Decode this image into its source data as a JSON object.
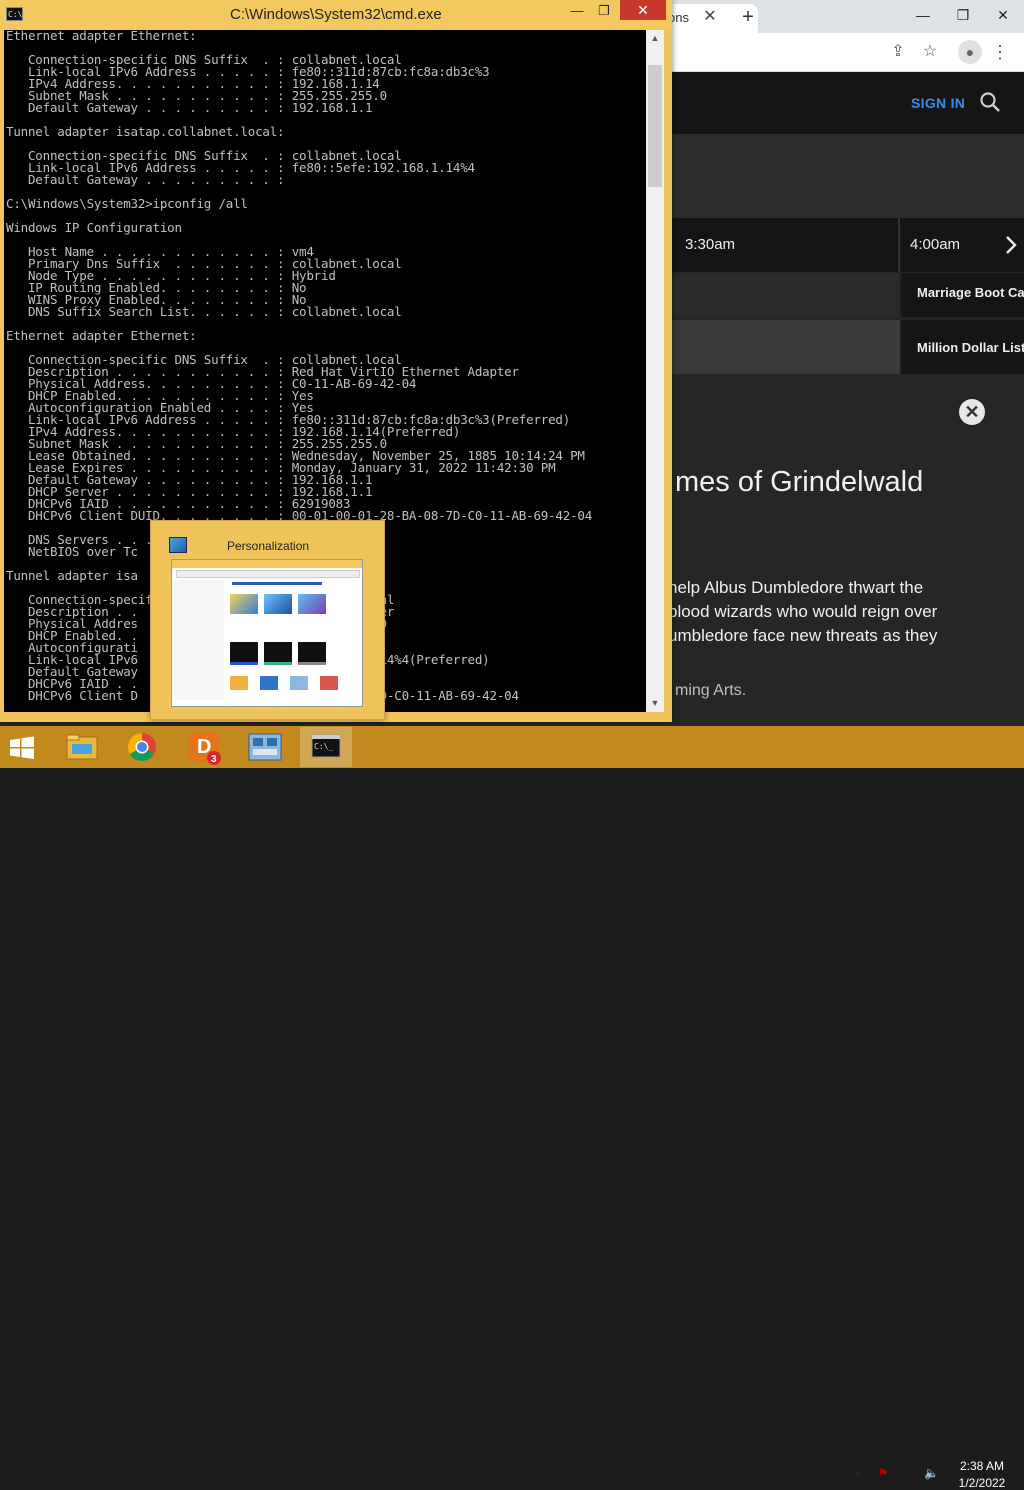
{
  "browser": {
    "tab_title": "ons",
    "tab_close": "✕",
    "new_tab": "+",
    "window_controls": {
      "minimize": "—",
      "maximize": "❐",
      "close": "✕"
    },
    "toolbar_icons": {
      "share": "⇪",
      "bookmark": "☆",
      "menu": "⋮"
    },
    "site": {
      "sign_in": "SIGN IN",
      "time_slots": [
        "3:30am",
        "4:00am"
      ],
      "programs": [
        "Marriage Boot Camp",
        "Million Dollar Listing"
      ],
      "close_symbol": "✕",
      "movie_title": "mes of Grindelwald",
      "description_lines": [
        " help Albus Dumbledore thwart the",
        "blood wizards who would reign over",
        "umbledore face new threats as they"
      ],
      "provider": "ming Arts."
    }
  },
  "cmd": {
    "title": "C:\\Windows\\System32\\cmd.exe",
    "icon_text": "C:\\",
    "controls": {
      "minimize": "—",
      "maximize": "❐",
      "close": "✕"
    },
    "scroll": {
      "up": "▲",
      "down": "▼"
    },
    "lines": [
      "Ethernet adapter Ethernet:",
      "",
      "   Connection-specific DNS Suffix  . : collabnet.local",
      "   Link-local IPv6 Address . . . . . : fe80::311d:87cb:fc8a:db3c%3",
      "   IPv4 Address. . . . . . . . . . . : 192.168.1.14",
      "   Subnet Mask . . . . . . . . . . . : 255.255.255.0",
      "   Default Gateway . . . . . . . . . : 192.168.1.1",
      "",
      "Tunnel adapter isatap.collabnet.local:",
      "",
      "   Connection-specific DNS Suffix  . : collabnet.local",
      "   Link-local IPv6 Address . . . . . : fe80::5efe:192.168.1.14%4",
      "   Default Gateway . . . . . . . . . :",
      "",
      "C:\\Windows\\System32>ipconfig /all",
      "",
      "Windows IP Configuration",
      "",
      "   Host Name . . . . . . . . . . . . : vm4",
      "   Primary Dns Suffix  . . . . . . . : collabnet.local",
      "   Node Type . . . . . . . . . . . . : Hybrid",
      "   IP Routing Enabled. . . . . . . . : No",
      "   WINS Proxy Enabled. . . . . . . . : No",
      "   DNS Suffix Search List. . . . . . : collabnet.local",
      "",
      "Ethernet adapter Ethernet:",
      "",
      "   Connection-specific DNS Suffix  . : collabnet.local",
      "   Description . . . . . . . . . . . : Red Hat VirtIO Ethernet Adapter",
      "   Physical Address. . . . . . . . . : C0-11-AB-69-42-04",
      "   DHCP Enabled. . . . . . . . . . . : Yes",
      "   Autoconfiguration Enabled . . . . : Yes",
      "   Link-local IPv6 Address . . . . . : fe80::311d:87cb:fc8a:db3c%3(Preferred)",
      "   IPv4 Address. . . . . . . . . . . : 192.168.1.14(Preferred)",
      "   Subnet Mask . . . . . . . . . . . : 255.255.255.0",
      "   Lease Obtained. . . . . . . . . . : Wednesday, November 25, 1885 10:14:24 PM",
      "   Lease Expires . . . . . . . . . . : Monday, January 31, 2022 11:42:30 PM",
      "   Default Gateway . . . . . . . . . : 192.168.1.1",
      "   DHCP Server . . . . . . . . . . . : 192.168.1.1",
      "   DHCPv6 IAID . . . . . . . . . . . : 62919083",
      "   DHCPv6 Client DUID. . . . . . . . : 00-01-00-01-28-BA-08-7D-C0-11-AB-69-42-04",
      "",
      "   DNS Servers . . . . . . . . . . . : 192.168.1.1",
      "   NetBIOS over Tc",
      "",
      "Tunnel adapter isa",
      "",
      "   Connection-specific                collabnet.local",
      "   Description . .                   t ISATAP Adapter",
      "   Physical Addres                   -00-00-00-00-E0",
      "   DHCP Enabled. .",
      "   Autoconfigurati",
      "   Link-local IPv6                   efe:192.168.1.14%4(Preferred)",
      "   Default Gateway                   2",
      "   DHCPv6 IAID . .",
      "   DHCPv6 Client D                   -01-28-BA-08-7D-C0-11-AB-69-42-04"
    ]
  },
  "personalization": {
    "title": "Personalization"
  },
  "taskbar": {
    "d3_badge": "3",
    "clock": {
      "time": "2:38 AM",
      "date": "1/2/2022"
    },
    "tray": {
      "chevron": "▲",
      "flag": "⚑",
      "network": "⌬",
      "volume": "🔈"
    }
  },
  "colors": {
    "cmd_frame": "#f0c45a",
    "taskbar": "#c28a1e",
    "sign_in": "#2f8ff0",
    "close_button": "#c7382b"
  }
}
